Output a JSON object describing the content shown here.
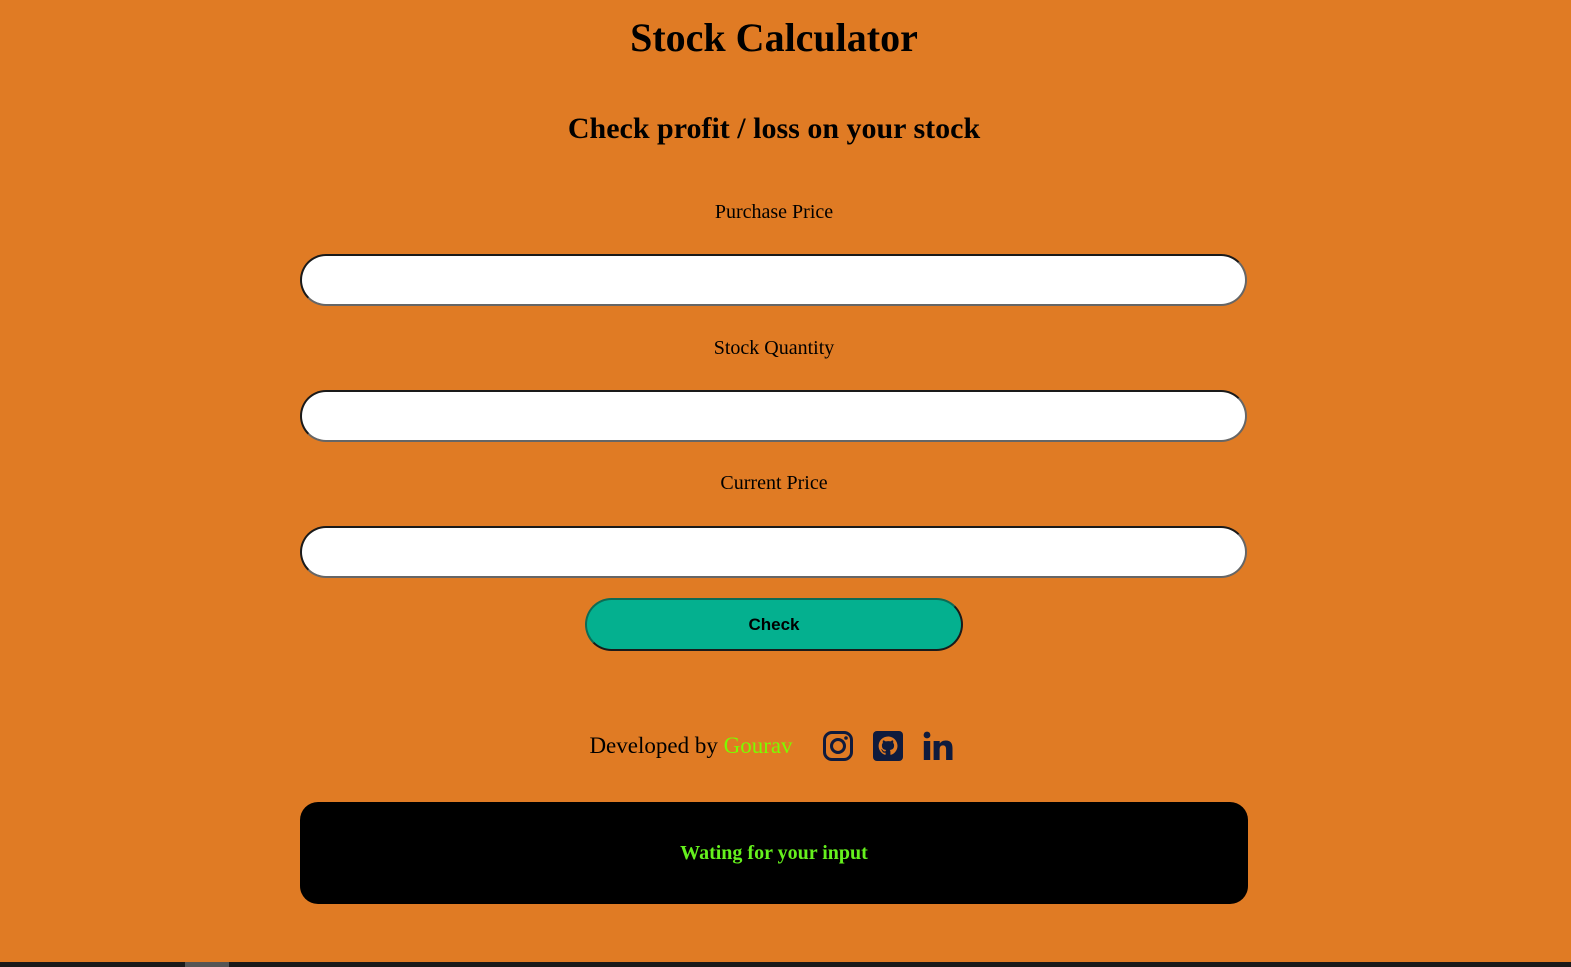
{
  "app": {
    "title": "Stock Calculator",
    "subtitle": "Check profit / loss on your stock"
  },
  "form": {
    "purchase_price": {
      "label": "Purchase Price",
      "value": "",
      "placeholder": ""
    },
    "stock_quantity": {
      "label": "Stock Quantity",
      "value": "",
      "placeholder": ""
    },
    "current_price": {
      "label": "Current Price",
      "value": "",
      "placeholder": ""
    },
    "check_label": "Check"
  },
  "footer": {
    "developed_by": "Developed by",
    "developer_name": "Gourav",
    "social_icons": [
      "instagram-icon",
      "github-icon",
      "linkedin-icon"
    ]
  },
  "output": {
    "message": "Wating for your input"
  },
  "colors": {
    "background": "#e07b24",
    "button": "#04b08f",
    "accent_name": "#7cfc00",
    "output_text": "#65f11d",
    "icon": "#0f1b3d"
  }
}
